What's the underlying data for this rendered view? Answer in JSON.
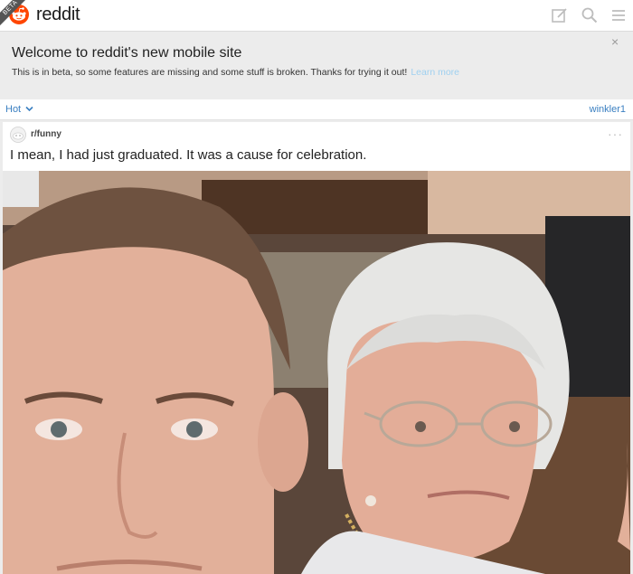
{
  "header": {
    "logo_text": "reddit",
    "beta_ribbon": "BETA",
    "icons": [
      "compose-icon",
      "search-icon",
      "menu-icon"
    ]
  },
  "banner": {
    "title": "Welcome to reddit's new mobile site",
    "text": "This is in beta, so some features are missing and some stuff is broken. Thanks for trying it out!",
    "link": "Learn more",
    "close": "×"
  },
  "sortbar": {
    "sort_label": "Hot",
    "user": "winkler1"
  },
  "post": {
    "subreddit": "r/funny",
    "more": "···",
    "title": "I mean, I had just graduated. It was a cause for celebration."
  },
  "colors": {
    "link": "#3a7fc1",
    "brand": "#ff4500"
  }
}
